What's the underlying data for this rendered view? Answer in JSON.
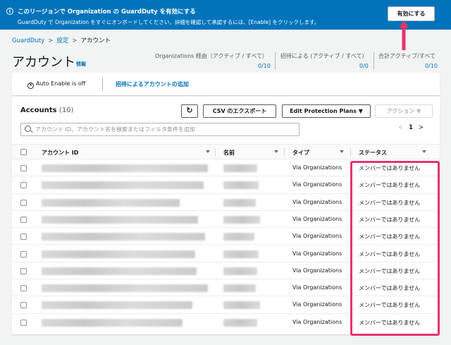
{
  "banner": {
    "title": "このリージョンで Organization の GuardDuty を有効にする",
    "description": "GuardDuty で Organization をすぐにオンボードしてください。詳細を確認して承認するには、[Enable] をクリックします。",
    "enable_button": "有効にする",
    "color": "#0073bb"
  },
  "breadcrumb": [
    "GuardDuty",
    "設定",
    "アカウント"
  ],
  "page": {
    "title": "アカウント",
    "info_link": "情報"
  },
  "stats": [
    {
      "label": "Organizations 経由（アクティブ / すべて）",
      "value": "0/10"
    },
    {
      "label": "招待による (アクティブ / すべて)",
      "value": "0/0"
    },
    {
      "label": "合計アクティブ/すべて",
      "value": "0/10"
    }
  ],
  "toolbar": {
    "auto_enable": "Auto Enable is off",
    "add_invite": "招待によるアカウントの追加"
  },
  "table": {
    "title": "Accounts",
    "count": "(10)",
    "refresh_icon": "refresh-icon",
    "csv_button": "CSV のエクスポート",
    "protection_button": "Edit Protection Plans",
    "action_button": "アクション",
    "search_placeholder": "アカウント ID、アカウント名を検索またはフィルタ条件を追加",
    "page_number": "1",
    "columns": [
      "アカウント ID",
      "名前",
      "タイプ",
      "ステータス"
    ],
    "rows": [
      {
        "type": "Via Organizations",
        "status": "メンバーではありません"
      },
      {
        "type": "Via Organizations",
        "status": "メンバーではありません"
      },
      {
        "type": "Via Organizations",
        "status": "メンバーではありません"
      },
      {
        "type": "Via Organizations",
        "status": "メンバーではありません"
      },
      {
        "type": "Via Organizations",
        "status": "メンバーではありません"
      },
      {
        "type": "Via Organizations",
        "status": "メンバーではありません"
      },
      {
        "type": "Via Organizations",
        "status": "メンバーではありません"
      },
      {
        "type": "Via Organizations",
        "status": "メンバーではありません"
      },
      {
        "type": "Via Organizations",
        "status": "メンバーではありません"
      },
      {
        "type": "Via Organizations",
        "status": "メンバーではありません"
      }
    ]
  },
  "annotation_color": "#e8336d"
}
